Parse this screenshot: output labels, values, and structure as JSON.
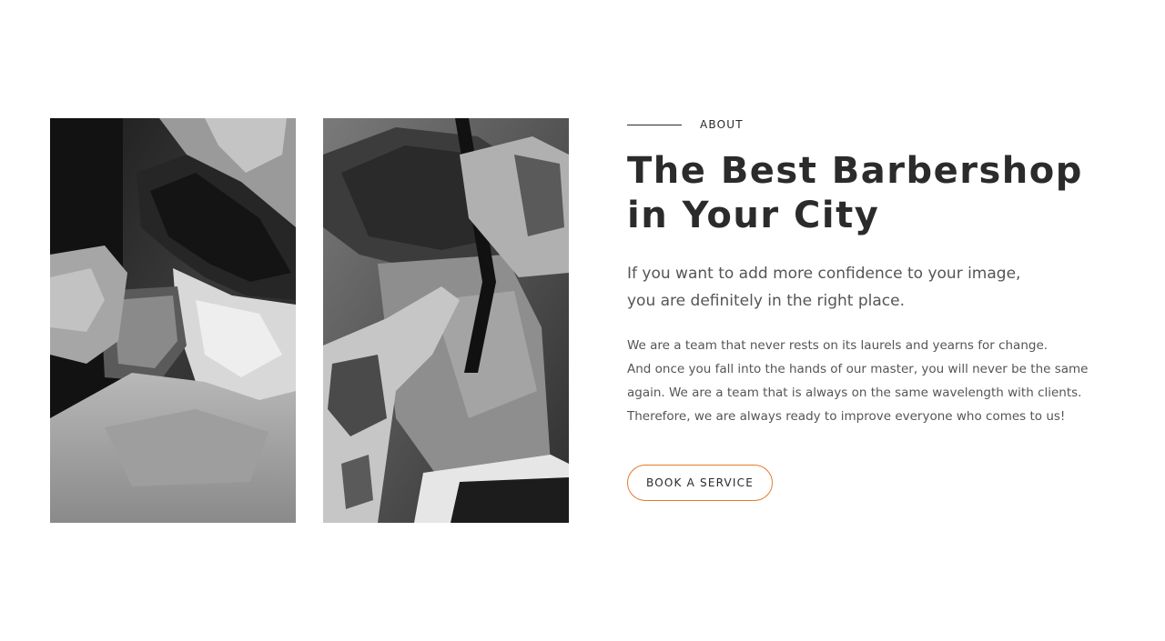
{
  "about": {
    "eyebrow": "ABOUT",
    "headline": "The Best Barbershop in Your City",
    "lead_line_1": "If you want to add more confidence to your image,",
    "lead_line_2": "you are definitely in the right place.",
    "body_line_1": "We are a team that never rests on its laurels and yearns for change.",
    "body_line_2": "And once you fall into the hands of our master, you will never be the same",
    "body_line_3": "again. We are a team that is always on the same wavelength with clients.",
    "body_line_4": "Therefore, we are always ready to improve everyone who comes to us!",
    "button_label": "BOOK A SERVICE"
  },
  "colors": {
    "accent": "#e8792b",
    "heading": "#2b2b2b",
    "text": "#555555"
  }
}
